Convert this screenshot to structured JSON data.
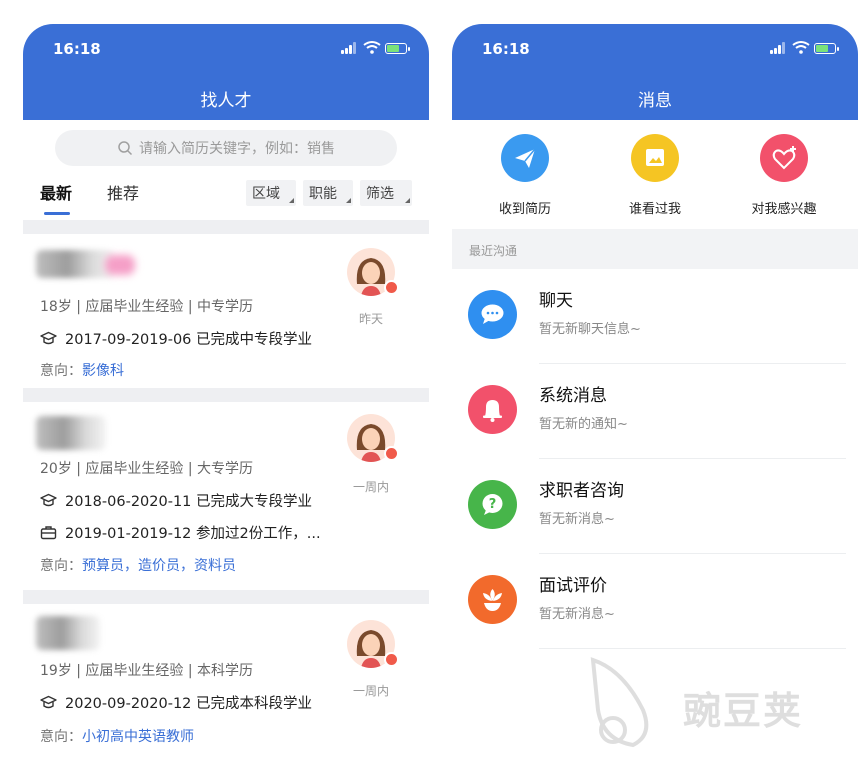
{
  "left": {
    "status_time": "16:18",
    "title": "找人才",
    "search_placeholder": "请输入简历关键字，例如：销售",
    "tabs": [
      "最新",
      "推荐"
    ],
    "filters": [
      "区域",
      "职能",
      "筛选"
    ],
    "candidates": [
      {
        "meta": "18岁 | 应届毕业生经验 | 中专学历",
        "education": "2017-09-2019-06 已完成中专段学业",
        "work": "",
        "intent_label": "意向：",
        "intent": "影像科",
        "time": "昨天"
      },
      {
        "meta": "20岁 | 应届毕业生经验 | 大专学历",
        "education": "2018-06-2020-11 已完成大专段学业",
        "work": "2019-01-2019-12 参加过2份工作，...",
        "intent_label": "意向：",
        "intent": "预算员，造价员，资料员",
        "time": "一周内"
      },
      {
        "meta": "19岁 | 应届毕业生经验 | 本科学历",
        "education": "2020-09-2020-12 已完成本科段学业",
        "work": "",
        "intent_label": "意向：",
        "intent": "小初高中英语教师",
        "time": "一周内"
      }
    ]
  },
  "right": {
    "status_time": "16:18",
    "title": "消息",
    "quick_actions": [
      {
        "label": "收到简历",
        "icon": "paper-plane-icon",
        "color": "#3a9af0"
      },
      {
        "label": "谁看过我",
        "icon": "photo-frame-icon",
        "color": "#f5c523"
      },
      {
        "label": "对我感兴趣",
        "icon": "heart-plus-icon",
        "color": "#f2516b"
      }
    ],
    "section_label": "最近沟通",
    "messages": [
      {
        "title": "聊天",
        "subtitle": "暂无新聊天信息~",
        "icon": "chat-bubble-icon",
        "color": "#2f8ff0"
      },
      {
        "title": "系统消息",
        "subtitle": "暂无新的通知~",
        "icon": "bell-icon",
        "color": "#f2516b"
      },
      {
        "title": "求职者咨询",
        "subtitle": "暂无新消息~",
        "icon": "question-icon",
        "color": "#47b54a"
      },
      {
        "title": "面试评价",
        "subtitle": "暂无新消息~",
        "icon": "flower-icon",
        "color": "#f26a2c"
      }
    ]
  },
  "watermark": "豌豆荚"
}
